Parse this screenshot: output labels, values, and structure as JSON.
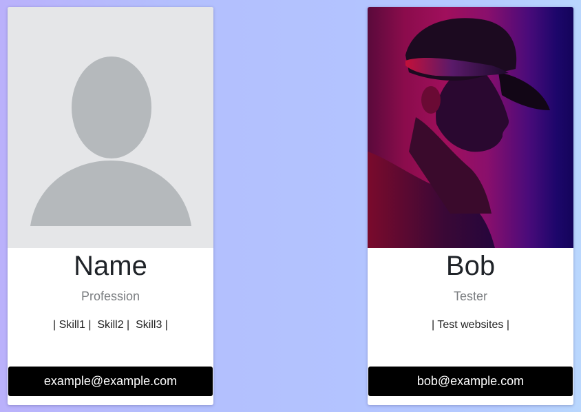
{
  "cards": [
    {
      "name": "Name",
      "profession": "Profession",
      "skills": "| Skill1 |  Skill2 |  Skill3 |",
      "email": "example@example.com",
      "photo_icon": "user-silhouette-icon"
    },
    {
      "name": "Bob",
      "profession": "Tester",
      "skills": "| Test websites |",
      "email": "bob@example.com",
      "photo_icon": "profile-photo"
    }
  ],
  "colors": {
    "email_button_bg": "#000000",
    "email_button_text": "#ffffff",
    "placeholder_bg": "#e5e6e8",
    "placeholder_silhouette": "#b5b9bc",
    "profession_text": "#7a7d80"
  }
}
